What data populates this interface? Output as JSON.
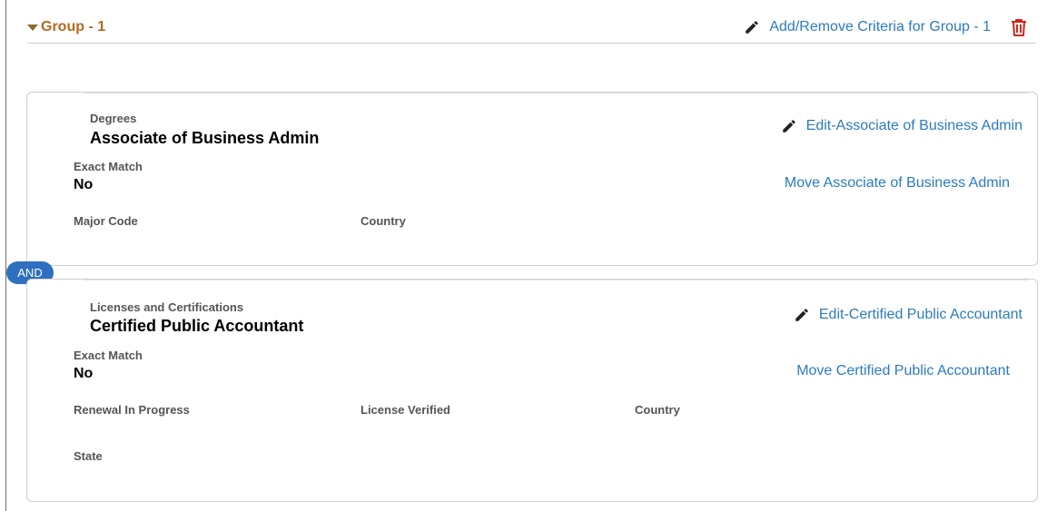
{
  "group": {
    "title": "Group - 1",
    "add_remove_label": "Add/Remove Criteria for Group - 1"
  },
  "connector": {
    "label": "AND"
  },
  "criteria": [
    {
      "category": "Degrees",
      "name": "Associate of Business Admin",
      "edit_label": "Edit-Associate of Business Admin",
      "move_label": "Move Associate of Business Admin",
      "exact_match_label": "Exact Match",
      "exact_match_value": "No",
      "fields": [
        "Major Code",
        "Country"
      ]
    },
    {
      "category": "Licenses and Certifications",
      "name": "Certified Public Accountant",
      "edit_label": "Edit-Certified Public Accountant",
      "move_label": "Move Certified Public Accountant",
      "exact_match_label": "Exact Match",
      "exact_match_value": "No",
      "fields": [
        "Renewal In Progress",
        "License Verified",
        "Country",
        "State"
      ]
    }
  ],
  "icons": {
    "edit": "pencil-icon",
    "delete": "trash-icon",
    "collapse": "caret-down-icon"
  },
  "colors": {
    "link": "#2b7bc0",
    "group_title": "#b46a1e",
    "badge": "#2f6fbf",
    "delete": "#d0261c"
  }
}
